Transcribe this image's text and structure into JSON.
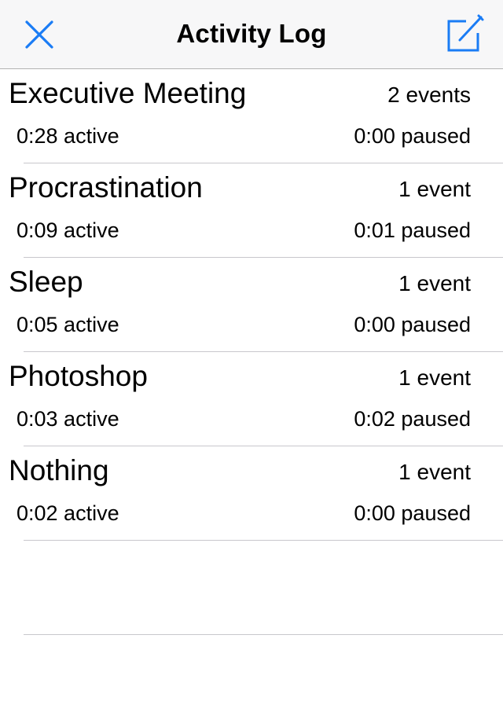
{
  "navbar": {
    "title": "Activity Log",
    "close_icon": "close-icon",
    "compose_icon": "compose-icon",
    "accent_color": "#1a7cf5"
  },
  "activities": [
    {
      "name": "Executive Meeting",
      "events": "2 events",
      "active": "0:28 active",
      "paused": "0:00 paused"
    },
    {
      "name": "Procrastination",
      "events": "1 event",
      "active": "0:09 active",
      "paused": "0:01 paused"
    },
    {
      "name": "Sleep",
      "events": "1 event",
      "active": "0:05 active",
      "paused": "0:00 paused"
    },
    {
      "name": "Photoshop",
      "events": "1 event",
      "active": "0:03 active",
      "paused": "0:02 paused"
    },
    {
      "name": "Nothing",
      "events": "1 event",
      "active": "0:02 active",
      "paused": "0:00 paused"
    }
  ]
}
